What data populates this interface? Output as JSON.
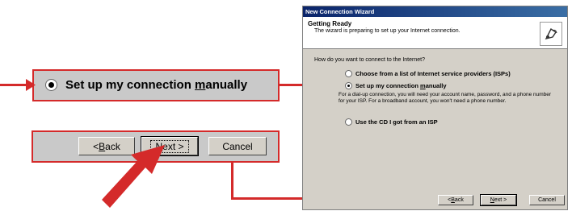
{
  "left_callout": {
    "radio_option_parts": [
      "Set up my connection ",
      "m",
      "anually"
    ],
    "back_parts": [
      "< ",
      "B",
      "ack"
    ],
    "next_parts": [
      "N",
      "ext >"
    ],
    "cancel_label": "Cancel"
  },
  "wizard": {
    "title": "New Connection Wizard",
    "header_title": "Getting Ready",
    "header_subtitle": "The wizard is preparing to set up your Internet connection.",
    "question": "How do you want to connect to the Internet?",
    "options": [
      {
        "label": "Choose from a list of Internet service providers (ISPs)",
        "selected": false
      },
      {
        "label_parts": [
          "Set up my connection ",
          "m",
          "anually"
        ],
        "selected": true,
        "description": "For a dial-up connection, you will need your account name, password, and a phone number for your ISP. For a broadband account, you won't need a phone number."
      },
      {
        "label": "Use the CD I got from an ISP",
        "selected": false
      }
    ],
    "buttons": {
      "back_parts": [
        "< ",
        "B",
        "ack"
      ],
      "next_parts": [
        "N",
        "ext >"
      ],
      "cancel": "Cancel"
    }
  },
  "colors": {
    "arrow": "#d42a2a",
    "callout_bg": "#c9c9c9",
    "dialog_bg": "#d4d0c8",
    "title_bar": "#0a246a"
  },
  "icons": {
    "header_icon": "network-connection-icon"
  }
}
